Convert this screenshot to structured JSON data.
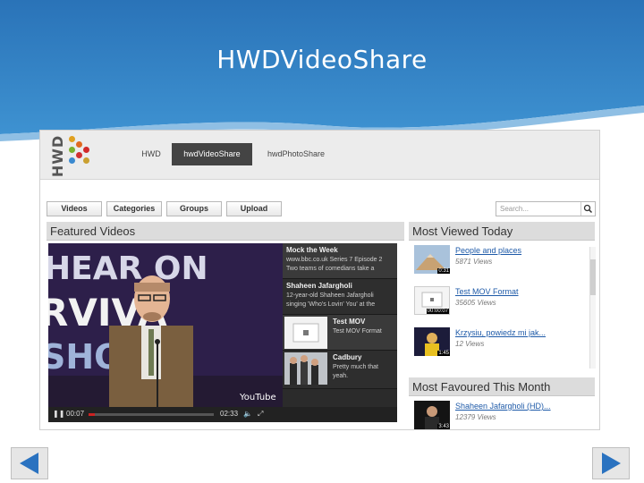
{
  "slide": {
    "title": "HWDVideoShare",
    "header_color": "#2f7fbf"
  },
  "site": {
    "logo_text": "HWD",
    "nav": [
      "HWD",
      "hwdVideoShare",
      "hwdPhotoShare"
    ],
    "active_nav": "hwdVideoShare",
    "toolbar": [
      "Videos",
      "Categories",
      "Groups",
      "Upload"
    ],
    "search_placeholder": "Search..."
  },
  "featured": {
    "heading": "Featured Videos",
    "player": {
      "current_time": "00:07",
      "total_time": "02:33",
      "progress": 0.05,
      "watermark": "YouTube"
    },
    "playlist": [
      {
        "title": "Mock the Week",
        "desc": [
          "www.bbc.co.uk Series 7 Episode 2",
          "Two teams of comedians take a"
        ]
      },
      {
        "title": "Shaheen Jafargholi",
        "desc": [
          "12-year-old Shaheen Jafargholi",
          "singing 'Who's Lovin' You' at the"
        ]
      },
      {
        "title": "Test MOV",
        "desc": [
          "Test MOV Format"
        ]
      },
      {
        "title": "Cadbury",
        "desc": [
          "Pretty much that",
          "yeah."
        ]
      }
    ]
  },
  "most_viewed": {
    "heading": "Most Viewed Today",
    "items": [
      {
        "title": "People and places",
        "views": "5871 Views",
        "duration": "0:31"
      },
      {
        "title": "Test MOV Format",
        "views": "35605 Views",
        "duration": "00:00:07"
      },
      {
        "title": "Krzysiu, powiedz mi jak...",
        "views": "12 Views",
        "duration": "1:45"
      }
    ]
  },
  "most_favoured": {
    "heading": "Most Favoured This Month",
    "items": [
      {
        "title": "Shaheen Jafargholi (HD)...",
        "views": "12379 Views",
        "duration": "3:43"
      }
    ]
  },
  "nav_buttons": {
    "prev_icon": "triangle-left",
    "next_icon": "triangle-right",
    "color": "#2a72c0"
  }
}
